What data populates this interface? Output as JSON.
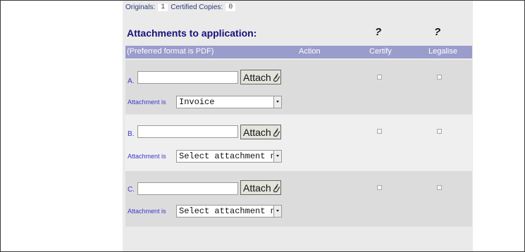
{
  "counts": {
    "originals_label": "Originals:",
    "originals_value": "1",
    "certified_label": "Certified Copies:",
    "certified_value": "0"
  },
  "section": {
    "title": "Attachments to application:",
    "certify_help": "?",
    "legalise_help": "?"
  },
  "header": {
    "format_note": "(Preferred format is PDF)",
    "action": "Action",
    "certify": "Certify",
    "legalise": "Legalise"
  },
  "rows": [
    {
      "letter": "A.",
      "attach_label": "Attach",
      "type_label": "Attachment is",
      "type_value": "Invoice",
      "certify_checked": false,
      "legalise_checked": false
    },
    {
      "letter": "B.",
      "attach_label": "Attach",
      "type_label": "Attachment is",
      "type_value": "Select attachment n",
      "certify_checked": false,
      "legalise_checked": false
    },
    {
      "letter": "C.",
      "attach_label": "Attach",
      "type_label": "Attachment is",
      "type_value": "Select attachment n",
      "certify_checked": false,
      "legalise_checked": false
    }
  ],
  "icons": {
    "attach": "paperclip-icon",
    "select": "chevron-down-icon"
  }
}
